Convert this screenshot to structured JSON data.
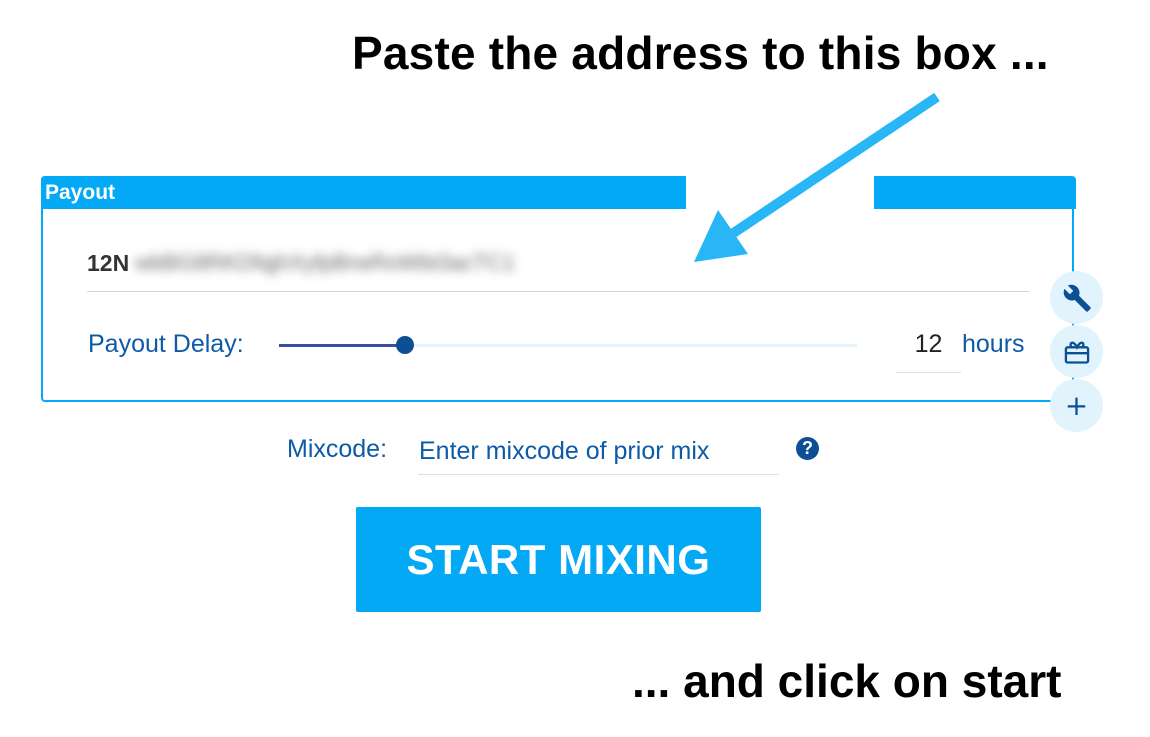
{
  "annotations": {
    "top": "Paste the address to this box ...",
    "bottom": "... and click on start"
  },
  "payout": {
    "title": "Payout",
    "address_prefix": "12N",
    "address_obscured": "wbBG8RKDfqjhXyfpBrwRoWbt3acTC1",
    "delay_label": "Payout Delay:",
    "delay_value": 12,
    "delay_unit": "hours",
    "delay_slider_fraction": 0.22
  },
  "side_buttons": {
    "settings_icon": "wrench-icon",
    "gift_icon": "gift-card-icon",
    "add_icon": "plus-icon",
    "add_symbol": "+"
  },
  "mixcode": {
    "label": "Mixcode:",
    "placeholder": "Enter mixcode of prior mix",
    "help_symbol": "?"
  },
  "start_button": {
    "label": "START MIXING"
  },
  "colors": {
    "accent": "#03a9f4",
    "text_blue": "#0d5aa7",
    "dark_blue": "#0d4f95",
    "arrow": "#29b6f6"
  }
}
